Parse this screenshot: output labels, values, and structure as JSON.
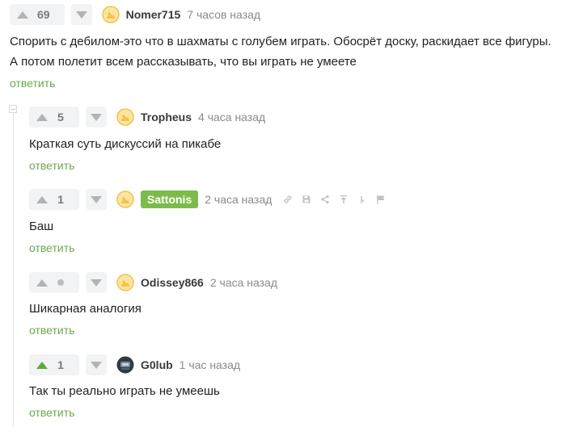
{
  "comments": [
    {
      "votes": "69",
      "author": "Nomer715",
      "time": "7 часов назад",
      "text": "Спорить с дебилом-это что в шахматы с голубем играть. Обосрёт доску, раскидает все фигуры. А потом полетит всем рассказывать, что вы играть не умеете",
      "reply": "ответить"
    },
    {
      "votes": "5",
      "author": "Tropheus",
      "time": "4 часа назад",
      "text": "Краткая суть дискуссий на пикабе",
      "reply": "ответить"
    },
    {
      "votes": "1",
      "author": "Sattonis",
      "time": "2 часа назад",
      "text": "Баш",
      "reply": "ответить"
    },
    {
      "votes": "",
      "author": "Odissey866",
      "time": "2 часа назад",
      "text": "Шикарная аналогия",
      "reply": "ответить"
    },
    {
      "votes": "1",
      "author": "G0lub",
      "time": "1 час назад",
      "text": "Так ты реально играть не умеешь",
      "reply": "ответить"
    }
  ],
  "colors": {
    "accent_green": "#6aa94c",
    "author_highlight": "#7cbb4a",
    "upvoted_arrow": "#5ea83a",
    "arrow_gray": "#b3b3b3"
  },
  "icons": [
    "arrow-up-icon",
    "arrow-down-icon",
    "link-icon",
    "save-icon",
    "share-icon",
    "pin-top-icon",
    "branch-icon",
    "flag-icon"
  ]
}
